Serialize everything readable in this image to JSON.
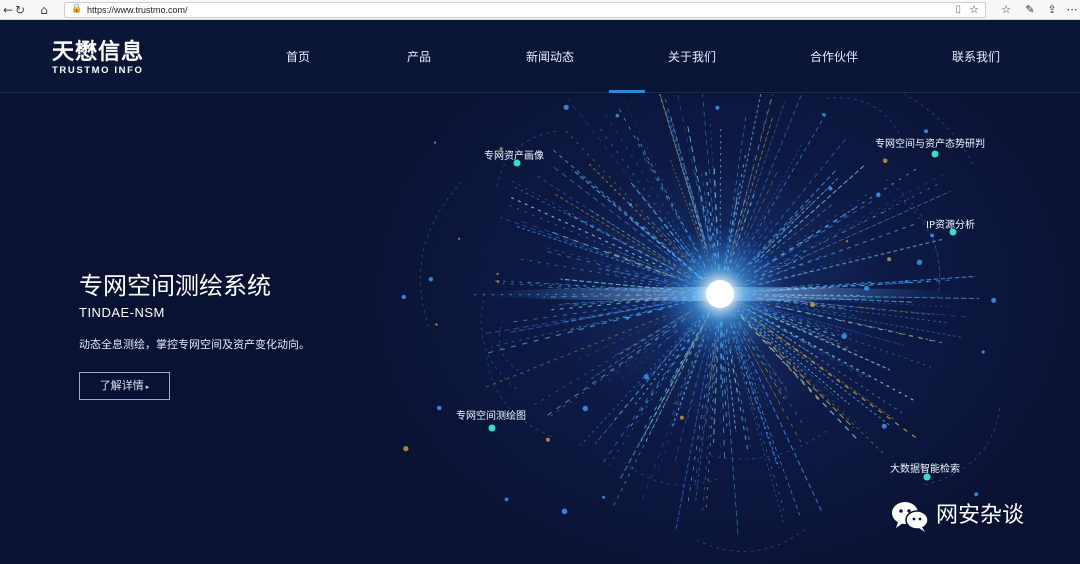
{
  "browser": {
    "url": "https://www.trustmo.com/"
  },
  "logo": {
    "cn": "天懋信息",
    "en": "TRUSTMO INFO"
  },
  "nav": {
    "items": [
      "首页",
      "产品",
      "新闻动态",
      "关于我们",
      "合作伙伴",
      "联系我们"
    ],
    "active_index": 3
  },
  "hero": {
    "title": "专网空间测绘系统",
    "subtitle": "TINDAE-NSM",
    "description": "动态全息测绘，掌控专网空间及资产变化动向。",
    "button_label": "了解详情",
    "button_arrow": "▸"
  },
  "features": {
    "asset_profile": "专网资产画像",
    "situation_research": "专网空间与资产态势研判",
    "ip_analysis": "IP资源分析",
    "mapping_graph": "专网空间测绘图",
    "bigdata_search": "大数据智能检索"
  },
  "watermark": {
    "text": "网安杂谈"
  },
  "colors": {
    "header_bg": "#0b1636",
    "hero_bg": "#0a1233",
    "accent": "#2a8ad8",
    "node": "#35e0c4"
  }
}
